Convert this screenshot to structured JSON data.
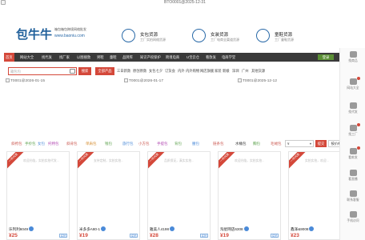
{
  "top": {
    "broken_image_alt": "BTO0001@2025-12-31"
  },
  "header": {
    "logo_text": "包牛牛",
    "slogan": "箱包箱包跨境网络批发",
    "site": "www.baoniu.com",
    "features": [
      {
        "title": "女包货源",
        "sub": "工厂实拍网络货源",
        "icon": "handbag-icon"
      },
      {
        "title": "女装货源",
        "sub": "工厂电商全渠道货源",
        "icon": "bag-icon"
      },
      {
        "title": "童鞋货源",
        "sub": "工厂童鞋货源",
        "icon": "shoe-icon"
      }
    ]
  },
  "nav": {
    "items": [
      "首页",
      "网站大全",
      "找代发",
      "找厂家",
      "以图搜款",
      "男鞋",
      "童鞋",
      "品牌库",
      "知识产权保护",
      "跨境电商",
      "U宝云仓",
      "看款发",
      "电商学堂"
    ],
    "login": "登录"
  },
  "search": {
    "placeholder": "箱包包",
    "button": "搜索"
  },
  "categories": {
    "highlight": "全部产品",
    "items": [
      "三日新款",
      "原创原款",
      "女包七夕",
      "订货会",
      "内外",
      "内外购物",
      "网店旗舰",
      "家装",
      "新娘",
      "深圳",
      "广州",
      "其他货源"
    ]
  },
  "banners": [
    "T0001@2026-01-15",
    "T0001@2026-01-17",
    "T0001@2025-12-12"
  ],
  "filters": {
    "items": [
      {
        "label": "斜挎包",
        "color": "#c9524a"
      },
      {
        "label": "手拎包",
        "color": "#5aa04a"
      },
      {
        "label": "女包",
        "color": "#4a8ad8"
      },
      {
        "label": "托特包",
        "color": "#b044b0"
      },
      {
        "label": "斜背包",
        "color": "#c9524a"
      },
      {
        "label": "单肩包",
        "color": "#d48a2a"
      },
      {
        "label": "钱包",
        "color": "#5aa04a"
      },
      {
        "label": "旅行包",
        "color": "#4a8ad8"
      },
      {
        "label": "小方包",
        "color": "#c9524a"
      },
      {
        "label": "手提包",
        "color": "#b044b0"
      },
      {
        "label": "背包",
        "color": "#5aa04a"
      },
      {
        "label": "腰包",
        "color": "#4a8ad8"
      },
      {
        "label": "链条包",
        "color": "#c9524a"
      },
      {
        "label": "水桶包",
        "color": "#333333"
      },
      {
        "label": "胸包",
        "color": "#5aa04a"
      },
      {
        "label": "毛绒包",
        "color": "#c9524a"
      }
    ],
    "sort_value": "¥",
    "sort_arrow": "▾",
    "sort_button": "提交",
    "sort_button2": "按价格"
  },
  "products": [
    {
      "name": "乐列利6049",
      "price": "¥25",
      "ribbon": "一件代发",
      "desc": "欢迎光临，实拍实拍代发...",
      "tag": "实拍"
    },
    {
      "name": "米多多A80-1",
      "price": "¥19",
      "ribbon": "一件代发",
      "desc": "支持定制，实拍实拍...",
      "tag": "实拍"
    },
    {
      "name": "雅美人4198",
      "price": "¥28",
      "ribbon": "一件代发",
      "desc": "品质保证，真实实拍...",
      "tag": "实拍"
    },
    {
      "name": "淘星网店6308",
      "price": "¥19",
      "ribbon": "一件代发",
      "desc": "欢迎光临，实拍实拍...",
      "tag": "实拍"
    },
    {
      "name": "鑫泽&9008",
      "price": "¥23",
      "ribbon": "一件代发",
      "desc": "实拍实拍，欢迎...",
      "tag": "实拍"
    }
  ],
  "rail": [
    {
      "label": "找商品",
      "icon": "cart-icon",
      "dot": false
    },
    {
      "label": "网站大全",
      "icon": "grid-icon",
      "dot": true
    },
    {
      "label": "找代发",
      "icon": "box-icon",
      "dot": false
    },
    {
      "label": "找工厂",
      "icon": "factory-icon",
      "dot": true
    },
    {
      "label": "看款发",
      "icon": "eye-icon",
      "dot": true
    },
    {
      "label": "看直播",
      "icon": "live-icon",
      "dot": false
    },
    {
      "label": "联系客服",
      "icon": "chat-icon",
      "dot": false
    },
    {
      "label": "手机访问",
      "icon": "phone-icon",
      "dot": false
    }
  ],
  "colors": {
    "accent": "#d4483a",
    "brand": "#1f5f9a",
    "nav_bg": "#3a3a3a",
    "login": "#5a8f34"
  }
}
